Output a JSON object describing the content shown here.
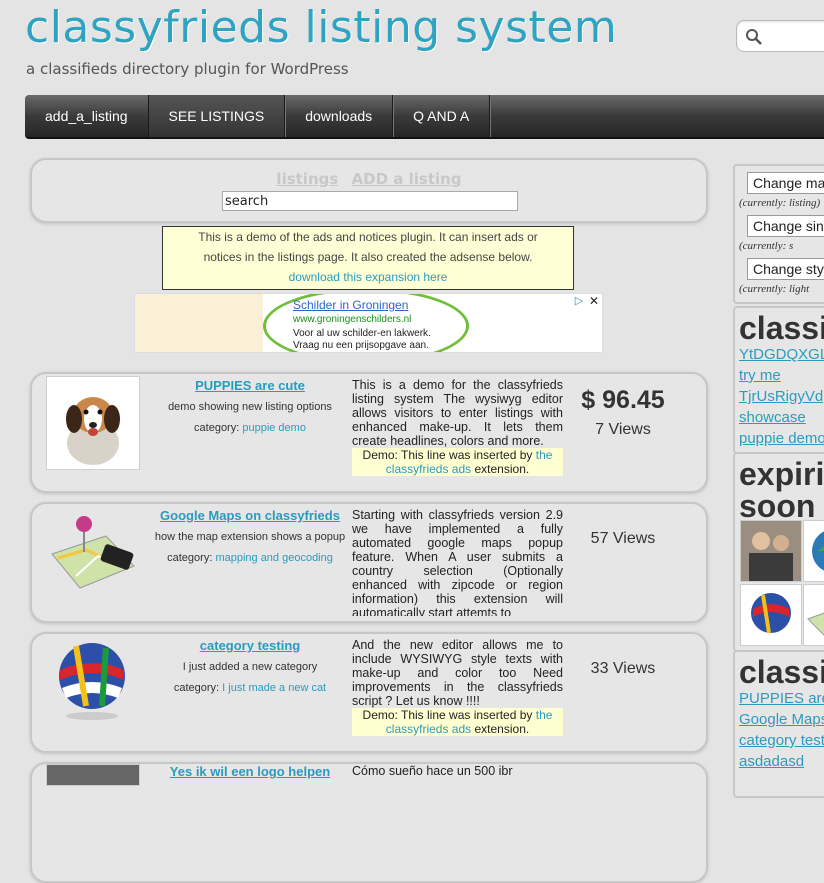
{
  "site": {
    "title": "classyfrieds listing system",
    "tagline": "a classifieds directory plugin for WordPress"
  },
  "nav": {
    "items": [
      {
        "label": "add_a_listing"
      },
      {
        "label": "SEE LISTINGS"
      },
      {
        "label": "downloads"
      },
      {
        "label": "Q AND A"
      }
    ]
  },
  "listings_box": {
    "tab_listings": "listings",
    "tab_add": "ADD a listing",
    "search_value": "search"
  },
  "notice": {
    "line1": "This is a demo of the ads and notices plugin. It can insert ads or",
    "line2": "notices in the listings page. It also created the adsense below.",
    "link": "download this expansion here"
  },
  "ad": {
    "title": "Schilder in Groningen",
    "url": "www.groningenschilders.nl",
    "line1": "Voor al uw schilder-en lakwerk.",
    "line2": "Vraag nu een prijsopgave aan."
  },
  "listings": [
    {
      "title": "PUPPIES are cute",
      "subtitle": "demo showing new listing options",
      "category_label": "category:",
      "category": "puppie demo",
      "description": "This is a demo for the classyfrieds listing system The wysiwyg editor allows visitors to enter listings with enhanced make-up. It lets them create headlines, colors and more.",
      "demo_prefix": "Demo: This line was inserted by",
      "demo_link1": "the",
      "demo_link2": "classyfrieds ads",
      "demo_suffix": "extension.",
      "price": "$ 96.45",
      "views": "7 Views"
    },
    {
      "title": "Google Maps on classyfrieds",
      "subtitle": "how the map extension shows a popup",
      "category_label": "category:",
      "category": "mapping and geocoding",
      "description": "Starting with classyfrieds version 2.9 we have implemented a fully automated google maps popup feature. When A user submits a country selection (Optionally enhanced with zipcode or region information) this extension will automatically start attemts to",
      "price": "",
      "views": "57 Views"
    },
    {
      "title": "category testing",
      "subtitle": "I just added a new category",
      "category_label": "category:",
      "category": "I just made a new cat",
      "description": "And the new editor allows me to include WYSIWYG style texts with make-up and color too Need improvements in the classyfrieds script ? Let us know !!!!",
      "demo_prefix": "Demo: This line was inserted by",
      "demo_link1": "the",
      "demo_link2": "classyfrieds ads",
      "demo_suffix": "extension.",
      "price": "",
      "views": "33 Views"
    }
  ],
  "partial_row": {
    "title": "Yes ik wil een logo helpen",
    "description": "Cómo sueño hace un 500 ibr"
  },
  "sidebar": {
    "change_buttons": [
      {
        "label": "Change map",
        "note": "(currently: listing)"
      },
      {
        "label": "Change single",
        "note": "(currently: s"
      },
      {
        "label": "Change style",
        "note": "(currently: light"
      }
    ],
    "classifieds_heading": "classifieds",
    "classifieds_links": [
      "YtDGDQXGLl",
      "try me",
      "TjrUsRigyVd",
      "showcase",
      "puppie demo"
    ],
    "expiring_heading_1": "expiring",
    "expiring_heading_2": "soon",
    "classifieds_heading_2": "classifieds",
    "recent_links": [
      "PUPPIES are cute",
      "Google Maps on",
      "category testing",
      "asdadasd"
    ]
  },
  "colors": {
    "accent": "#2ea3c2",
    "link": "#2a9bbf",
    "nav_dark": "#2b2b2b",
    "background": "#e4e4e4"
  }
}
